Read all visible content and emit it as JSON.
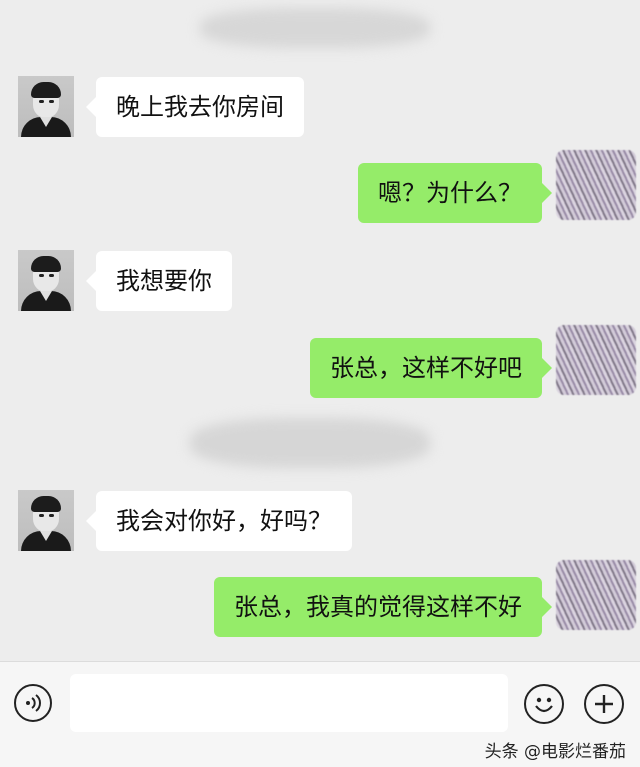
{
  "messages": [
    {
      "side": "left",
      "text": "晚上我去你房间"
    },
    {
      "side": "right",
      "text": "嗯？为什么？"
    },
    {
      "side": "left",
      "text": "我想要你"
    },
    {
      "side": "right",
      "text": "张总，这样不好吧"
    },
    {
      "side": "left",
      "text": "我会对你好，好吗？"
    },
    {
      "side": "right",
      "text": "张总，我真的觉得这样不好"
    }
  ],
  "colors": {
    "background": "#ededed",
    "incoming_bubble": "#ffffff",
    "outgoing_bubble": "#95ec69"
  },
  "input_bar": {
    "icons": [
      "voice-icon",
      "emoji-icon",
      "plus-icon"
    ],
    "value": ""
  },
  "watermark": {
    "text": "头条 @电影烂番茄"
  }
}
